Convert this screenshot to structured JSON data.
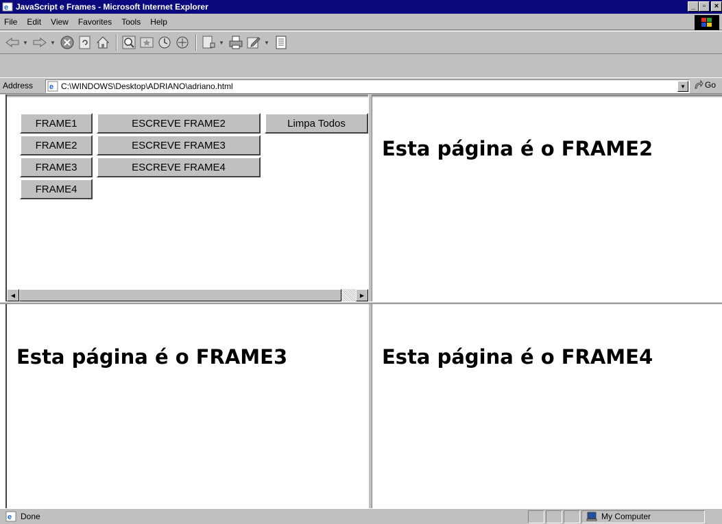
{
  "window": {
    "title": "JavaScript e Frames - Microsoft Internet Explorer",
    "min_glyph": "_",
    "max_glyph": "▫",
    "close_glyph": "×"
  },
  "menu": {
    "items": [
      {
        "label": "File"
      },
      {
        "label": "Edit"
      },
      {
        "label": "View"
      },
      {
        "label": "Favorites"
      },
      {
        "label": "Tools"
      },
      {
        "label": "Help"
      }
    ]
  },
  "toolbar": {
    "icons": [
      "back-icon",
      "forward-icon",
      "stop-icon",
      "refresh-icon",
      "home-icon",
      "search-icon",
      "favorites-icon",
      "history-icon",
      "channels-icon",
      "mail-icon",
      "print-icon",
      "edit-icon",
      "discuss-icon"
    ]
  },
  "address": {
    "label": "Address",
    "value": "C:\\WINDOWS\\Desktop\\ADRIANO\\adriano.html",
    "go_label": "Go"
  },
  "frame1": {
    "buttons_col1": [
      "FRAME1",
      "FRAME2",
      "FRAME3",
      "FRAME4"
    ],
    "buttons_col2": [
      "ESCREVE FRAME2",
      "ESCREVE FRAME3",
      "ESCREVE FRAME4"
    ],
    "clear_label": "Limpa Todos"
  },
  "frame2": {
    "heading": "Esta página é o FRAME2"
  },
  "frame3": {
    "heading": "Esta página é o FRAME3"
  },
  "frame4": {
    "heading": "Esta página é o FRAME4"
  },
  "status": {
    "text": "Done",
    "zone": "My Computer"
  },
  "colors": {
    "titlebar": "#0a0a7e",
    "chrome": "#c0c0c0"
  }
}
